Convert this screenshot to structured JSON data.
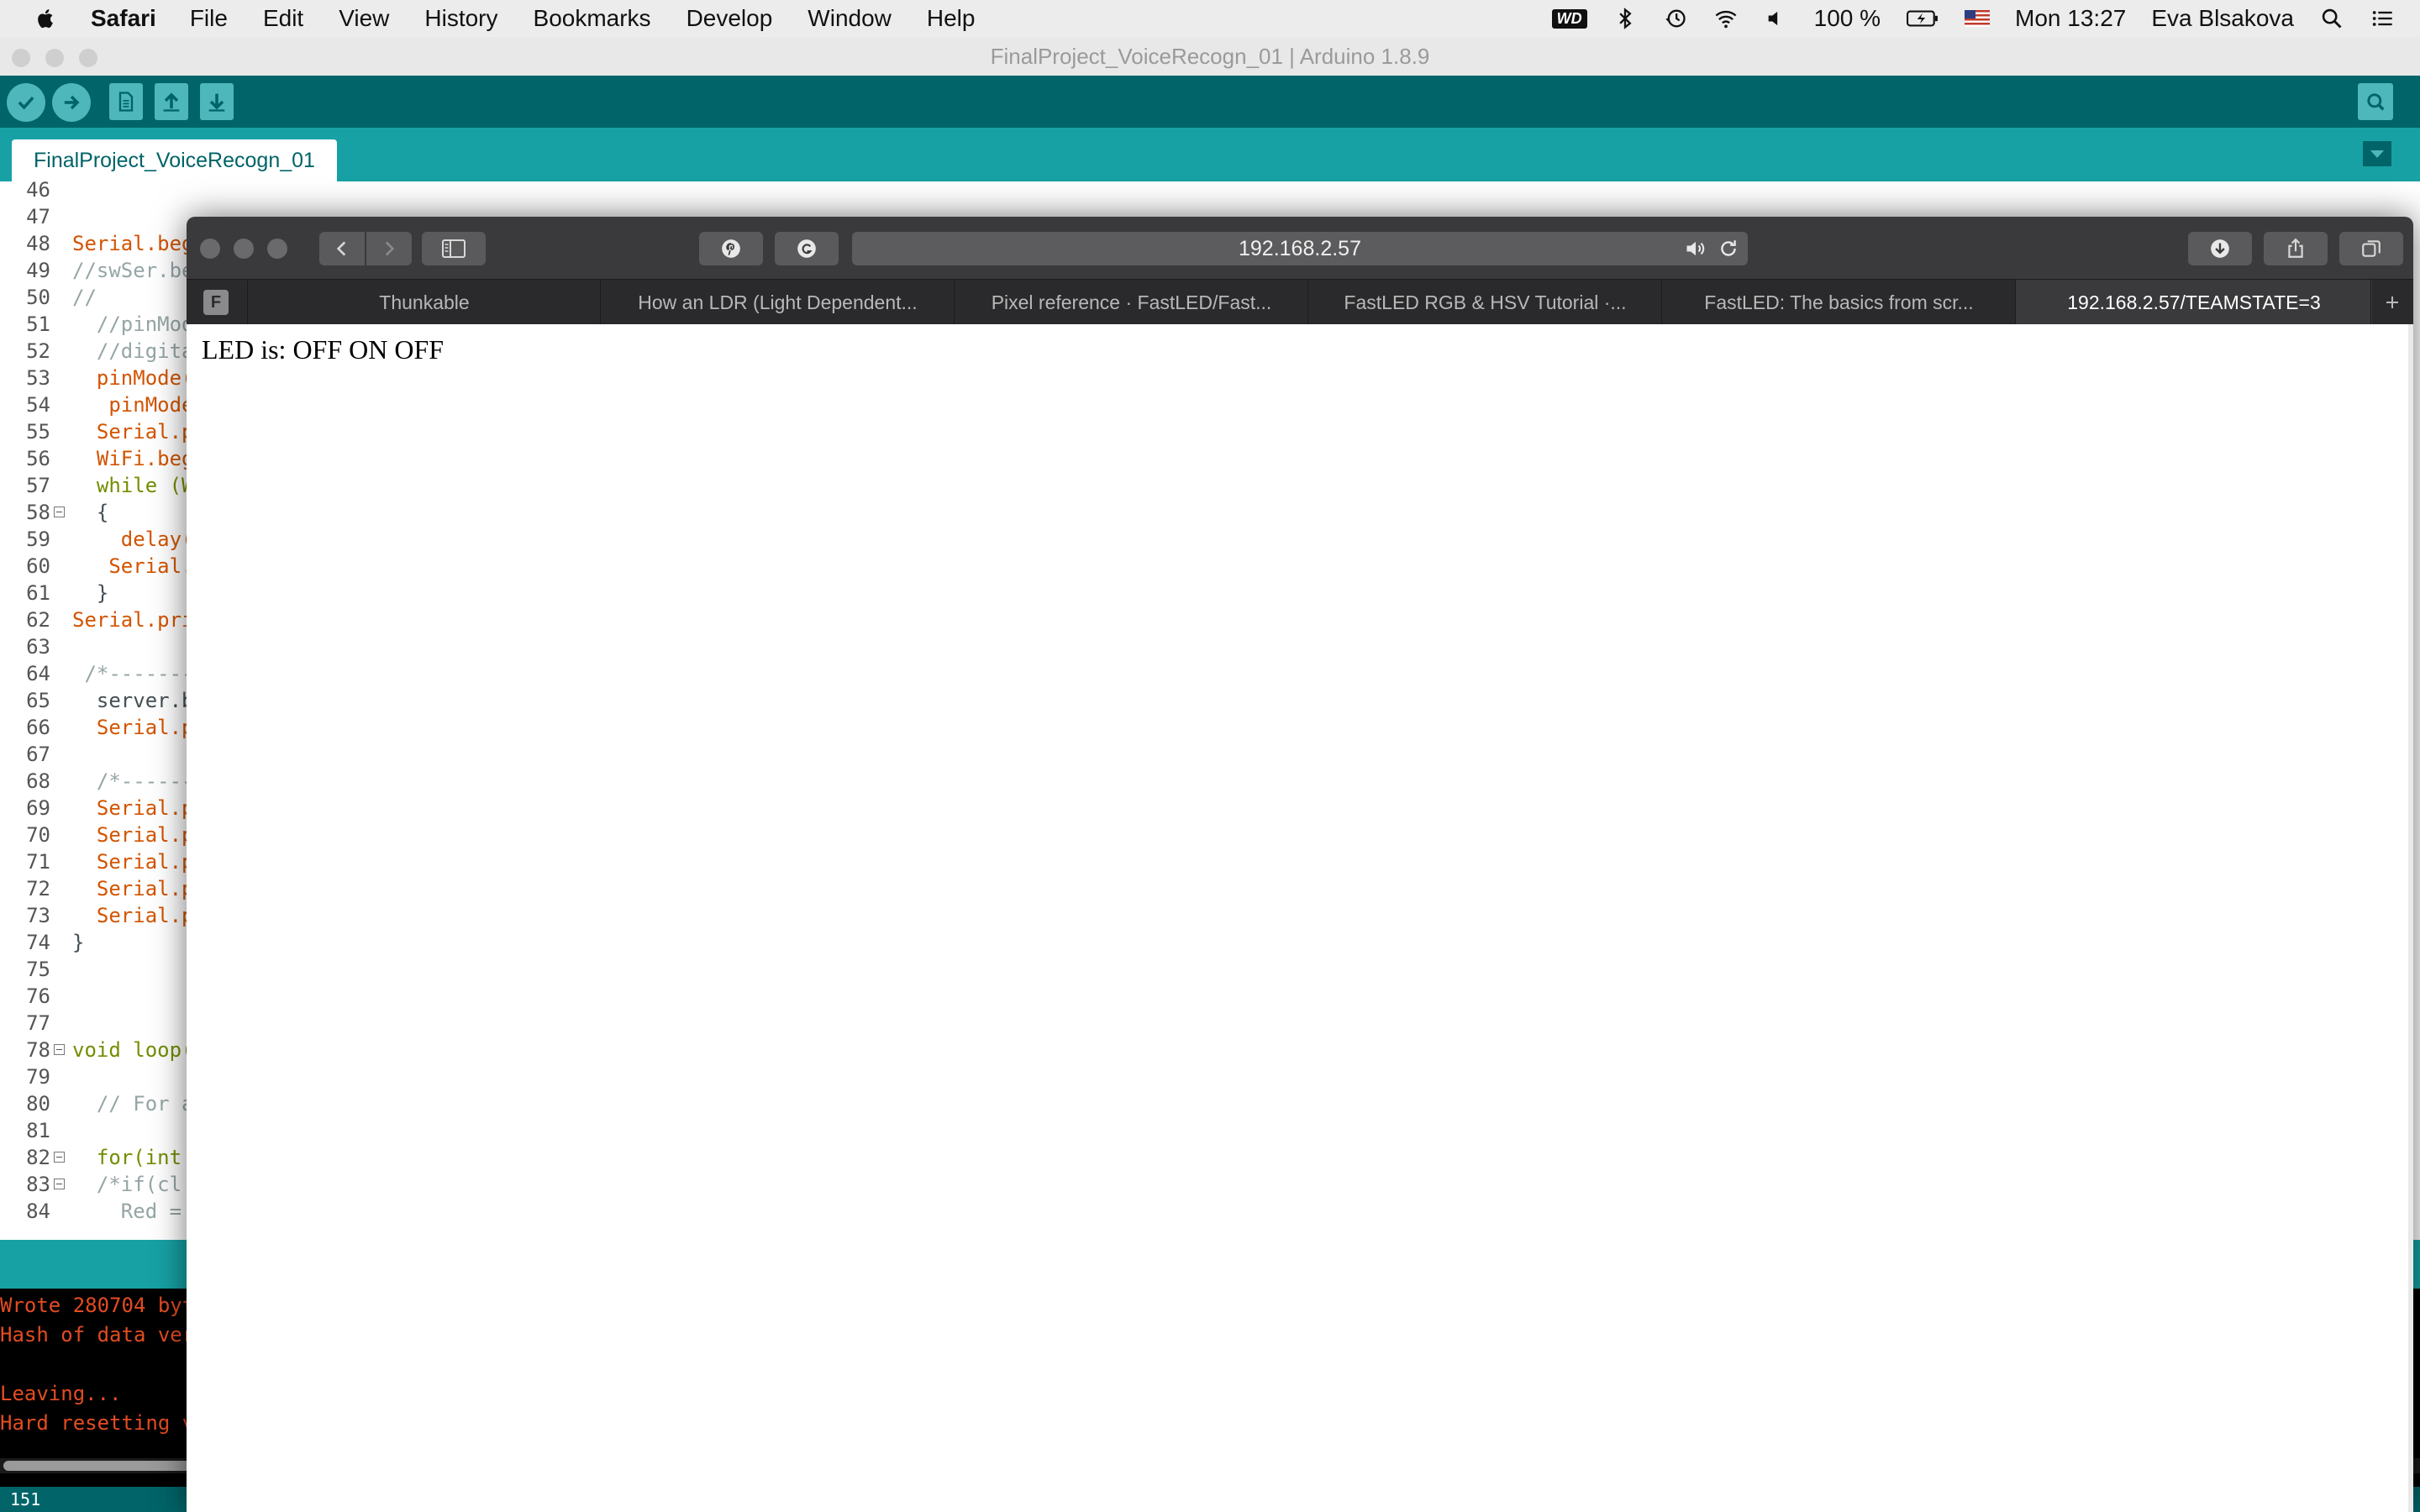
{
  "menubar": {
    "app": "Safari",
    "items": [
      "File",
      "Edit",
      "View",
      "History",
      "Bookmarks",
      "Develop",
      "Window",
      "Help"
    ],
    "wd_badge": "WD",
    "battery": "100 %",
    "clock": "Mon 13:27",
    "user": "Eva Blsakova"
  },
  "arduino": {
    "title": "FinalProject_VoiceRecogn_01 | Arduino 1.8.9",
    "tab": "FinalProject_VoiceRecogn_01",
    "lines": [
      {
        "n": "46",
        "t": "",
        "c": "plain"
      },
      {
        "n": "47",
        "t": "",
        "c": "plain"
      },
      {
        "n": "48",
        "t": "Serial.beg",
        "c": "orange"
      },
      {
        "n": "49",
        "t": "//swSer.be",
        "c": "comment"
      },
      {
        "n": "50",
        "t": "//",
        "c": "comment"
      },
      {
        "n": "51",
        "t": "  //pinMod",
        "c": "comment"
      },
      {
        "n": "52",
        "t": "  //digita",
        "c": "comment"
      },
      {
        "n": "53",
        "t": "  pinMode(",
        "c": "orange"
      },
      {
        "n": "54",
        "t": "   pinMode",
        "c": "orange"
      },
      {
        "n": "55",
        "t": "  Serial.p",
        "c": "orange"
      },
      {
        "n": "56",
        "t": "  WiFi.beg",
        "c": "orange"
      },
      {
        "n": "57",
        "t": "  while (W",
        "c": "kw"
      },
      {
        "n": "58",
        "t": "  {",
        "c": "plain",
        "fold": true
      },
      {
        "n": "59",
        "t": "    delay(",
        "c": "orange"
      },
      {
        "n": "60",
        "t": "   Serial.",
        "c": "orange"
      },
      {
        "n": "61",
        "t": "  }",
        "c": "plain"
      },
      {
        "n": "62",
        "t": "Serial.pri",
        "c": "orange"
      },
      {
        "n": "63",
        "t": "",
        "c": "plain"
      },
      {
        "n": "64",
        "t": " /*-------",
        "c": "comment"
      },
      {
        "n": "65",
        "t": "  server.b",
        "c": "plain"
      },
      {
        "n": "66",
        "t": "  Serial.p",
        "c": "orange"
      },
      {
        "n": "67",
        "t": "",
        "c": "plain"
      },
      {
        "n": "68",
        "t": "  /*------",
        "c": "comment"
      },
      {
        "n": "69",
        "t": "  Serial.p",
        "c": "orange"
      },
      {
        "n": "70",
        "t": "  Serial.p",
        "c": "orange"
      },
      {
        "n": "71",
        "t": "  Serial.p",
        "c": "orange"
      },
      {
        "n": "72",
        "t": "  Serial.p",
        "c": "orange"
      },
      {
        "n": "73",
        "t": "  Serial.p",
        "c": "orange"
      },
      {
        "n": "74",
        "t": "}",
        "c": "plain"
      },
      {
        "n": "75",
        "t": "",
        "c": "plain"
      },
      {
        "n": "76",
        "t": "",
        "c": "plain"
      },
      {
        "n": "77",
        "t": "",
        "c": "plain"
      },
      {
        "n": "78",
        "t": "void loop(",
        "c": "kw",
        "fold": true
      },
      {
        "n": "79",
        "t": "",
        "c": "plain"
      },
      {
        "n": "80",
        "t": "  // For a",
        "c": "comment"
      },
      {
        "n": "81",
        "t": "",
        "c": "plain"
      },
      {
        "n": "82",
        "t": "  for(int ",
        "c": "kw",
        "fold": true
      },
      {
        "n": "83",
        "t": "  /*if(cl",
        "c": "comment",
        "fold": true
      },
      {
        "n": "84",
        "t": "    Red = ",
        "c": "comment"
      }
    ],
    "console": [
      "Wrote 280704 byt",
      "Hash of data ver",
      "",
      "Leaving...",
      "Hard resetting v"
    ],
    "footer_line": "151"
  },
  "safari": {
    "address": "192.168.2.57",
    "pinned_tab": "F",
    "tabs": [
      {
        "label": "Thunkable",
        "active": false
      },
      {
        "label": "How an LDR (Light Dependent...",
        "active": false
      },
      {
        "label": "Pixel reference · FastLED/Fast...",
        "active": false
      },
      {
        "label": "FastLED RGB & HSV Tutorial ·...",
        "active": false
      },
      {
        "label": "FastLED: The basics from scr...",
        "active": false
      },
      {
        "label": "192.168.2.57/TEAMSTATE=3",
        "active": true
      }
    ],
    "content": "LED is: OFF ON OFF"
  }
}
